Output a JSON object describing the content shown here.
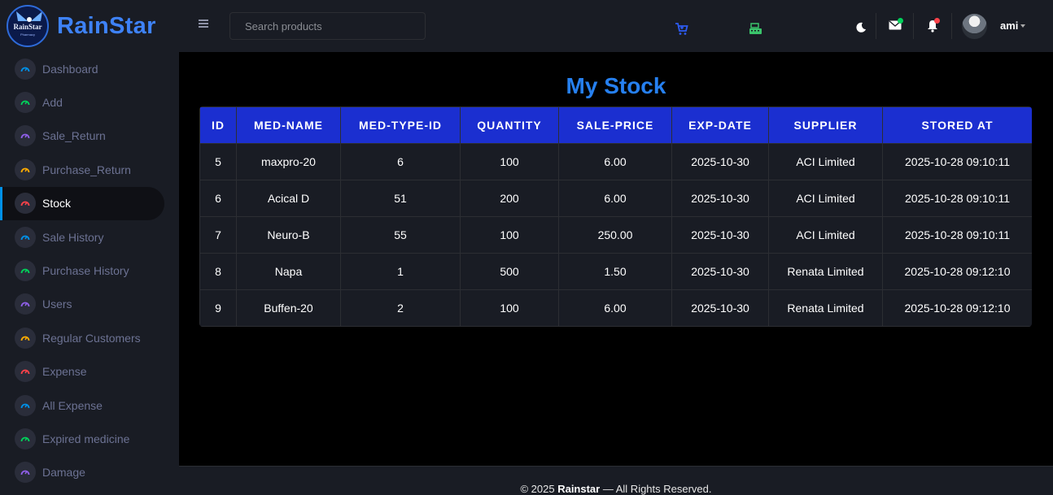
{
  "brand": {
    "name": "RainStar",
    "logo_text": "RainStar",
    "logo_subtext": "Pharmacy"
  },
  "sidebar": {
    "items": [
      {
        "label": "Dashboard",
        "color": "#0090e7"
      },
      {
        "label": "Add",
        "color": "#00d25b"
      },
      {
        "label": "Sale_Return",
        "color": "#8f5fe8"
      },
      {
        "label": "Purchase_Return",
        "color": "#ffab00"
      },
      {
        "label": "Stock",
        "color": "#fc424a",
        "active": true
      },
      {
        "label": "Sale History",
        "color": "#0090e7"
      },
      {
        "label": "Purchase History",
        "color": "#00d25b"
      },
      {
        "label": "Users",
        "color": "#8f5fe8"
      },
      {
        "label": "Regular Customers",
        "color": "#ffab00"
      },
      {
        "label": "Expense",
        "color": "#fc424a"
      },
      {
        "label": "All Expense",
        "color": "#0090e7"
      },
      {
        "label": "Expired medicine",
        "color": "#00d25b"
      },
      {
        "label": "Damage",
        "color": "#8f5fe8"
      }
    ]
  },
  "topbar": {
    "search_placeholder": "Search products",
    "icons": [
      "cart-icon",
      "cash-register-icon",
      "theme-toggle-icon",
      "mail-icon",
      "bell-icon"
    ],
    "username": "ami"
  },
  "main": {
    "title": "My Stock",
    "columns": [
      "ID",
      "MED-NAME",
      "MED-TYPE-ID",
      "QUANTITY",
      "SALE-PRICE",
      "EXP-DATE",
      "SUPPLIER",
      "STORED AT"
    ],
    "rows": [
      [
        "5",
        "maxpro-20",
        "6",
        "100",
        "6.00",
        "2025-10-30",
        "ACI Limited",
        "2025-10-28 09:10:11"
      ],
      [
        "6",
        "Acical D",
        "51",
        "200",
        "6.00",
        "2025-10-30",
        "ACI Limited",
        "2025-10-28 09:10:11"
      ],
      [
        "7",
        "Neuro-B",
        "55",
        "100",
        "250.00",
        "2025-10-30",
        "ACI Limited",
        "2025-10-28 09:10:11"
      ],
      [
        "8",
        "Napa",
        "1",
        "500",
        "1.50",
        "2025-10-30",
        "Renata Limited",
        "2025-10-28 09:12:10"
      ],
      [
        "9",
        "Buffen-20",
        "2",
        "100",
        "6.00",
        "2025-10-30",
        "Renata Limited",
        "2025-10-28 09:12:10"
      ]
    ]
  },
  "footer": {
    "prefix": "© 2025 ",
    "brand": "Rainstar",
    "suffix": " — All Rights Reserved."
  },
  "colors": {
    "header_bg": "#1b2fd0",
    "title": "#2680f0",
    "brand": "#3e82f7",
    "panel": "#191c24"
  }
}
